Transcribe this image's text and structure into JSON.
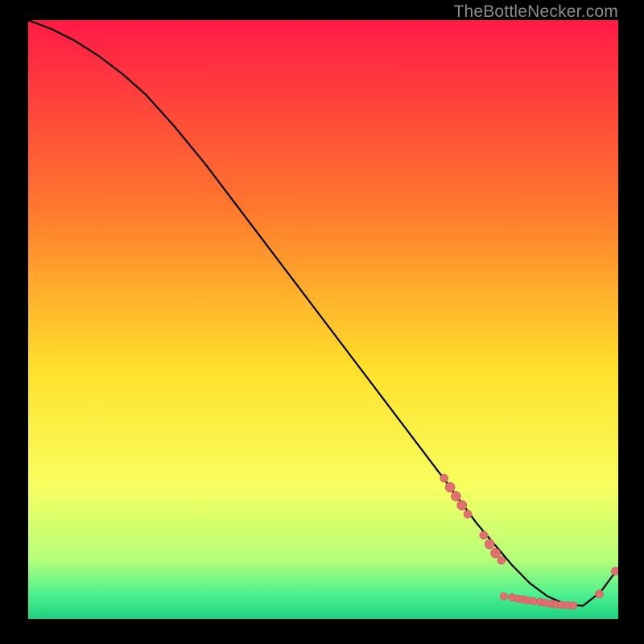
{
  "watermark": "TheBottleNecker.com",
  "colors": {
    "grad_top": "#ff1a46",
    "grad_mid_up": "#ff7a2d",
    "grad_mid": "#ffe02a",
    "grad_mid_low": "#f7ff60",
    "grad_low1": "#b6ff7a",
    "grad_low2": "#4bf08e",
    "grad_bottom": "#1fd07f",
    "curve": "#000000",
    "dot_fill": "#e07070",
    "dot_stroke": "#c95858"
  },
  "chart_data": {
    "type": "line",
    "title": "",
    "xlabel": "",
    "ylabel": "",
    "xlim": [
      0,
      100
    ],
    "ylim": [
      0,
      100
    ],
    "series": [
      {
        "name": "bottleneck-curve",
        "x": [
          0,
          4,
          8,
          12,
          16,
          20,
          25,
          30,
          35,
          40,
          45,
          50,
          55,
          60,
          65,
          70,
          73,
          76,
          79,
          82,
          85,
          88,
          91,
          94,
          97,
          100
        ],
        "y": [
          100,
          98.5,
          96.5,
          94,
          91,
          87.5,
          82,
          76,
          69.5,
          63,
          56.5,
          50,
          43.5,
          37,
          30.5,
          24,
          20,
          16,
          12.5,
          9,
          6,
          3.8,
          2.5,
          2.2,
          4.5,
          8.5
        ]
      }
    ],
    "markers": [
      {
        "x": 70.5,
        "y": 23.5,
        "r": 5
      },
      {
        "x": 71.5,
        "y": 22.0,
        "r": 6
      },
      {
        "x": 72.5,
        "y": 20.5,
        "r": 6
      },
      {
        "x": 73.5,
        "y": 19.0,
        "r": 6
      },
      {
        "x": 74.5,
        "y": 17.5,
        "r": 5
      },
      {
        "x": 77.2,
        "y": 14.0,
        "r": 5
      },
      {
        "x": 78.2,
        "y": 12.5,
        "r": 6
      },
      {
        "x": 79.2,
        "y": 11.0,
        "r": 6
      },
      {
        "x": 80.2,
        "y": 9.8,
        "r": 5
      },
      {
        "x": 80.6,
        "y": 3.8,
        "r": 4.7
      },
      {
        "x": 82.0,
        "y": 3.6,
        "r": 4.7
      },
      {
        "x": 83.0,
        "y": 3.4,
        "r": 4.7
      },
      {
        "x": 83.8,
        "y": 3.3,
        "r": 4.7
      },
      {
        "x": 84.6,
        "y": 3.15,
        "r": 4.7
      },
      {
        "x": 85.6,
        "y": 3.0,
        "r": 4.7
      },
      {
        "x": 86.8,
        "y": 2.85,
        "r": 4.7
      },
      {
        "x": 87.6,
        "y": 2.7,
        "r": 4.7
      },
      {
        "x": 88.6,
        "y": 2.55,
        "r": 4.7
      },
      {
        "x": 89.4,
        "y": 2.45,
        "r": 4.7
      },
      {
        "x": 90.4,
        "y": 2.35,
        "r": 4.7
      },
      {
        "x": 91.4,
        "y": 2.3,
        "r": 4.7
      },
      {
        "x": 92.4,
        "y": 2.25,
        "r": 4.7
      },
      {
        "x": 96.8,
        "y": 4.2,
        "r": 5
      },
      {
        "x": 99.5,
        "y": 8.0,
        "r": 5
      }
    ]
  }
}
